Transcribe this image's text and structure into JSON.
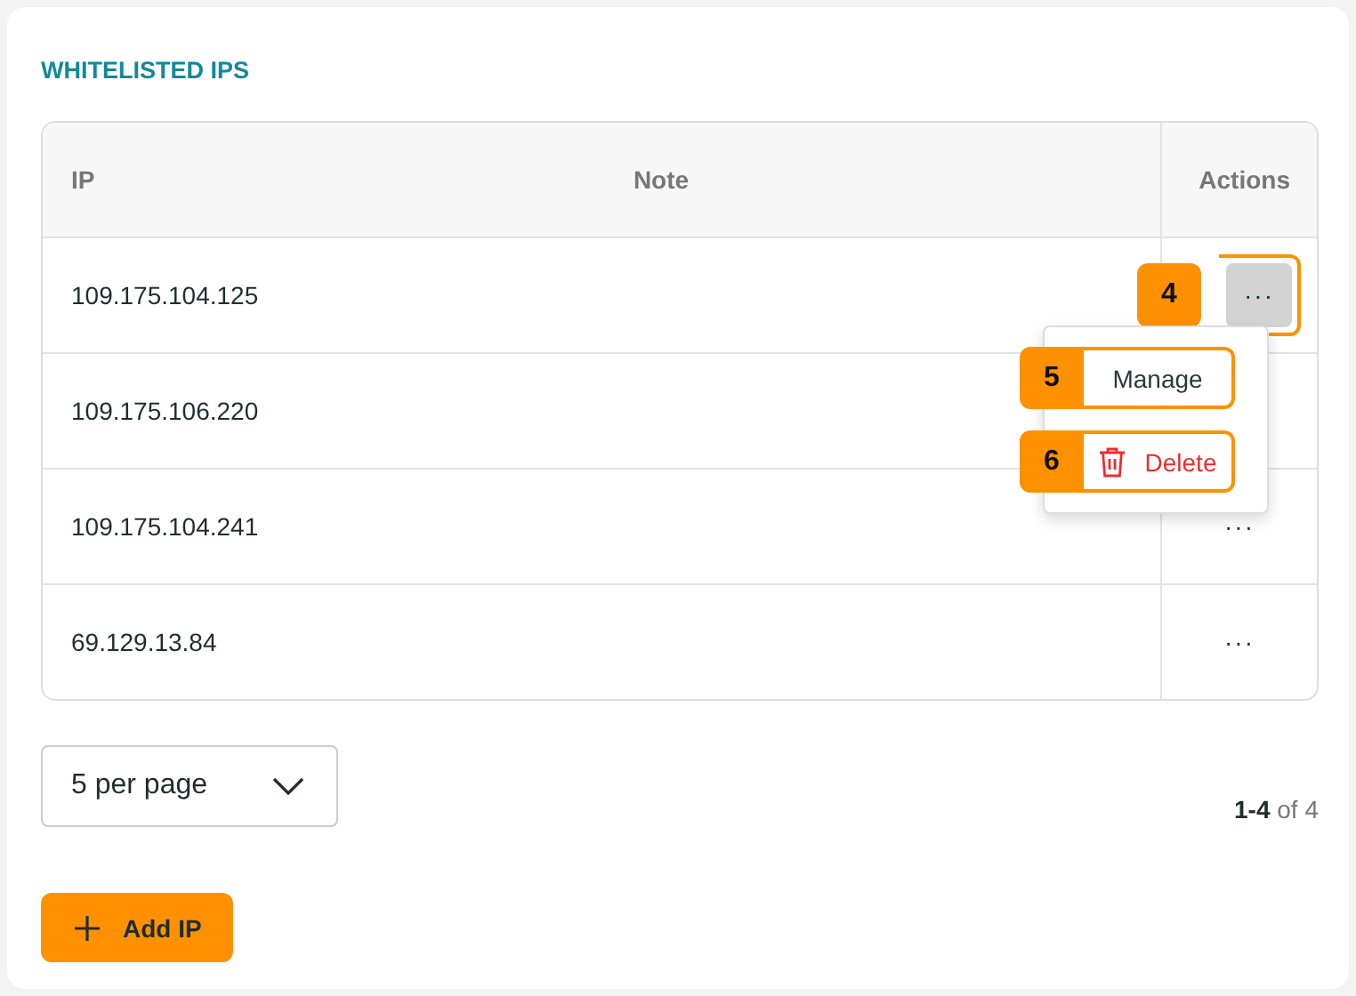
{
  "section_title": "WHITELISTED IPS",
  "table": {
    "columns": [
      "IP",
      "Note",
      "Actions"
    ],
    "rows": [
      {
        "ip": "109.175.104.125",
        "actions": "···",
        "open": true,
        "badge": "4"
      },
      {
        "ip": "109.175.106.220"
      },
      {
        "ip": "109.175.104.241",
        "actions": "···",
        "open": false
      },
      {
        "ip": "69.129.13.84",
        "actions": "···",
        "open": false
      }
    ]
  },
  "menu": {
    "items": [
      {
        "kind": "plain",
        "label": "Manage",
        "badge": "5"
      },
      {
        "kind": "danger",
        "label": "Delete",
        "badge": "6"
      }
    ]
  },
  "pagination": {
    "per_page": "5 per page",
    "range": "**1-4** of 4"
  },
  "add_button": "Add IP"
}
